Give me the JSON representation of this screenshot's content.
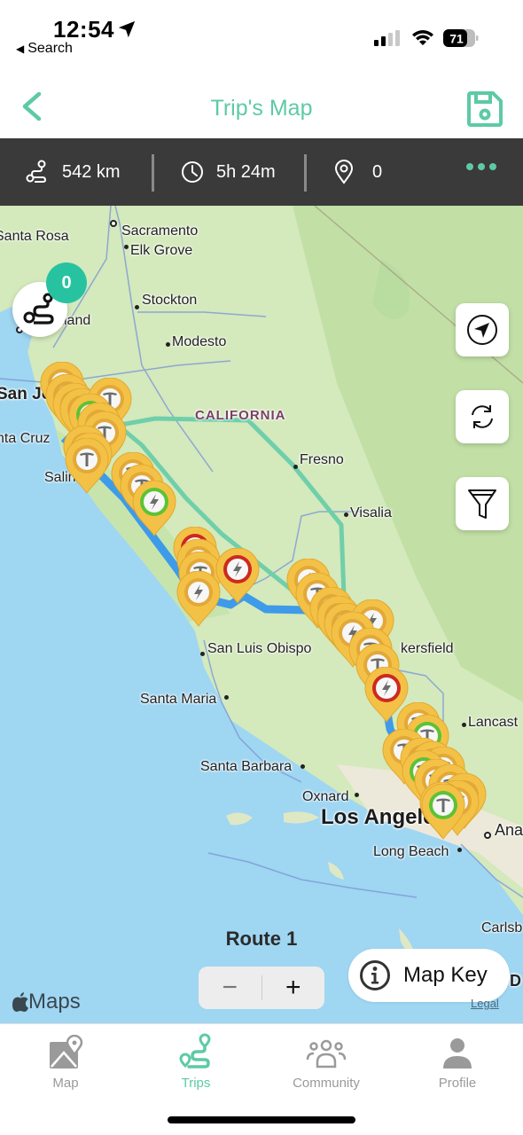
{
  "status_bar": {
    "time": "12:54",
    "back_app": "Search",
    "battery": "71"
  },
  "header": {
    "title": "Trip's Map"
  },
  "stats": {
    "distance": "542 km",
    "duration": "5h 24m",
    "stops": "0"
  },
  "map": {
    "state_label": "CALIFORNIA",
    "trip_count": "0",
    "route_label": "Route 1",
    "map_key_label": "Map Key",
    "attribution": "Maps",
    "legal": "Legal",
    "zoom_out": "−",
    "zoom_in": "+",
    "cities": [
      {
        "name": "Santa Rosa"
      },
      {
        "name": "Sacramento"
      },
      {
        "name": "Elk Grove"
      },
      {
        "name": "Stockton"
      },
      {
        "name": "kland"
      },
      {
        "name": "Modesto"
      },
      {
        "name": "San Jo"
      },
      {
        "name": "nta Cruz"
      },
      {
        "name": "Salin"
      },
      {
        "name": "Fresno"
      },
      {
        "name": "Visalia"
      },
      {
        "name": "San Luis Obispo"
      },
      {
        "name": "kersfield"
      },
      {
        "name": "Santa Maria"
      },
      {
        "name": "Lancast"
      },
      {
        "name": "Santa Barbara"
      },
      {
        "name": "Oxnard"
      },
      {
        "name": "Los Angele"
      },
      {
        "name": "Ana"
      },
      {
        "name": "Long Beach"
      },
      {
        "name": "Carlsb"
      },
      {
        "name": "D"
      }
    ],
    "colors": {
      "route_primary": "#3d9be9",
      "route_alt": "#6fcfaa",
      "pin": "#f4c147",
      "available": "#5cc334",
      "unavailable": "#cc2a1f"
    }
  },
  "tabs": [
    {
      "label": "Map",
      "icon": "map-icon",
      "active": false
    },
    {
      "label": "Trips",
      "icon": "route-icon",
      "active": true
    },
    {
      "label": "Community",
      "icon": "community-icon",
      "active": false
    },
    {
      "label": "Profile",
      "icon": "profile-icon",
      "active": false
    }
  ],
  "accent_color": "#5dcaa5"
}
